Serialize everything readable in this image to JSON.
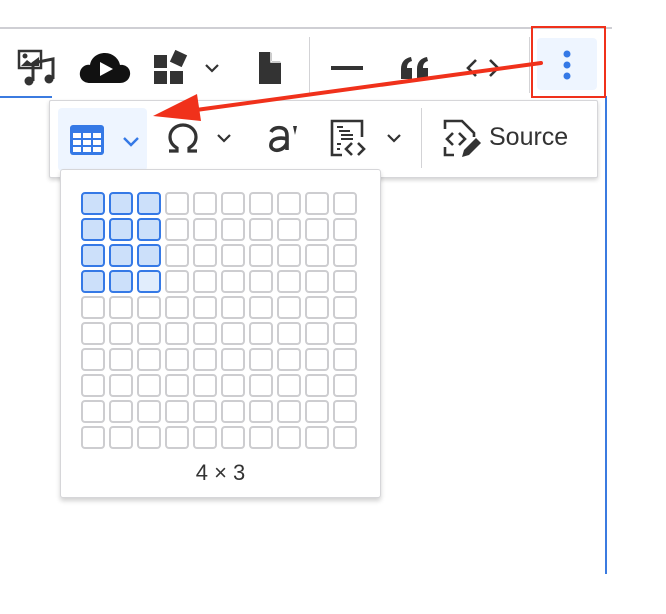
{
  "toolbar": {
    "buttons": [
      {
        "name": "insert-media",
        "icon": "media-music-icon"
      },
      {
        "name": "insert-video",
        "icon": "cloud-play-icon"
      },
      {
        "name": "insert-widget",
        "icon": "widgets-icon",
        "has_dropdown": true
      },
      {
        "name": "insert-page",
        "icon": "file-icon"
      },
      {
        "name": "horizontal-line",
        "icon": "horizontal-line-icon"
      },
      {
        "name": "blockquote",
        "icon": "quote-icon"
      },
      {
        "name": "code",
        "icon": "code-icon"
      },
      {
        "name": "show-more-items",
        "icon": "vertical-dots-icon",
        "highlighted": true
      }
    ]
  },
  "overflow_toolbar": {
    "buttons": [
      {
        "name": "insert-table",
        "icon": "table-icon",
        "has_dropdown": true,
        "active": true
      },
      {
        "name": "special-characters",
        "icon": "omega-icon",
        "has_dropdown": true
      },
      {
        "name": "text-part-language",
        "icon": "language-icon"
      },
      {
        "name": "insert-code-block",
        "icon": "code-block-icon",
        "has_dropdown": true
      },
      {
        "name": "source",
        "icon": "source-edit-icon",
        "label": "Source"
      }
    ]
  },
  "table_picker": {
    "rows": 10,
    "columns": 10,
    "selected_rows": 4,
    "selected_columns": 3,
    "size_label": "4 × 3"
  },
  "annotation": {
    "arrow_color": "#f0311b",
    "highlight_color": "#f0311b"
  },
  "colors": {
    "accent": "#3579e6",
    "active_bg": "#eef5ff",
    "icon": "#333333"
  }
}
